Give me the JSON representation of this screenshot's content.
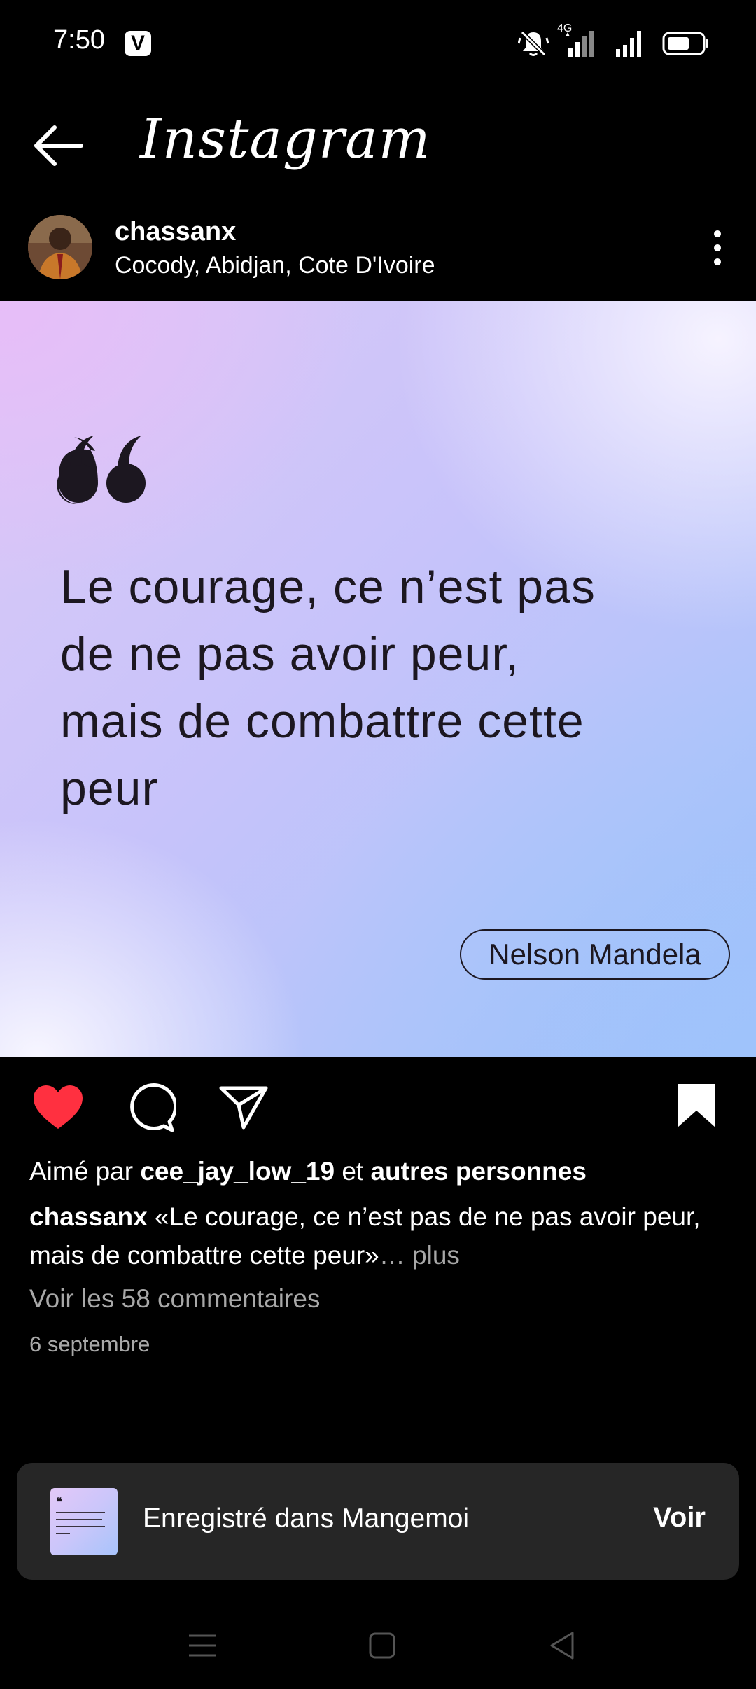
{
  "status_bar": {
    "time": "7:50",
    "carrier_badge": "V",
    "network_label": "4G",
    "icons": [
      "mute-bell-icon",
      "signal-icon",
      "signal-icon",
      "battery-icon"
    ]
  },
  "app_bar": {
    "back_icon": "arrow-left-icon",
    "title": "Instagram"
  },
  "post": {
    "username": "chassanx",
    "location": "Cocody, Abidjan, Cote D'Ivoire",
    "image": {
      "quote_lines": [
        "Le courage, ce n’est pas",
        "de ne pas avoir peur,",
        "mais de combattre cette",
        "peur"
      ],
      "author": "Nelson Mandela"
    },
    "liked": true,
    "saved": true,
    "likes": {
      "prefix": "Aimé par ",
      "user": "cee_jay_low_19",
      "middle": " et ",
      "others": "autres personnes"
    },
    "caption": {
      "user": "chassanx",
      "text": " «Le courage, ce n’est pas de ne pas avoir peur, mais de combattre cette peur»",
      "more": "… plus"
    },
    "comments_link": "Voir les 58 commentaires",
    "date": "6 septembre"
  },
  "toast": {
    "text": "Enregistré dans Mangemoi",
    "action": "Voir"
  },
  "nav_bar": {
    "icons": [
      "menu-icon",
      "home-square-icon",
      "back-triangle-icon"
    ]
  },
  "colors": {
    "background": "#000000",
    "like_red": "#ff3040",
    "secondary_text": "#a8a8a8",
    "toast_bg": "#262626"
  }
}
